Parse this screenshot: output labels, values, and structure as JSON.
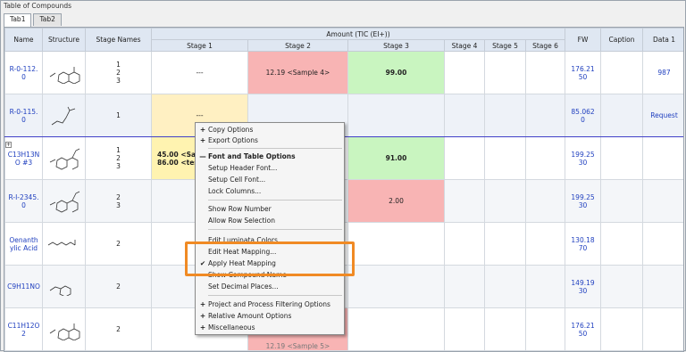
{
  "window": {
    "title": "Table of Compounds"
  },
  "tabs": [
    {
      "label": "Tab1"
    },
    {
      "label": "Tab2"
    }
  ],
  "headers": {
    "name": "Name",
    "structure": "Structure",
    "stage_names": "Stage Names",
    "amount_group": "Amount (TIC (EI+))",
    "stages": [
      "Stage 1",
      "Stage 2",
      "Stage 3",
      "Stage 4",
      "Stage 5",
      "Stage 6"
    ],
    "fw": "FW",
    "caption": "Caption",
    "data1": "Data 1"
  },
  "rows": [
    {
      "name": "R-0-112.\n0",
      "stages": "1\n2\n3",
      "s1": "---",
      "s2": "12.19 <Sample 4>",
      "s3": "99.00",
      "fw": "176.21\n50",
      "data1": "987"
    },
    {
      "name": "R-0-115.\n0",
      "stages": "1",
      "s1": "---",
      "s2": "",
      "s3": "",
      "fw": "85.062\n0",
      "data1": "Request"
    },
    {
      "name": "C13H13N\nO #3",
      "stages": "1\n2\n3",
      "s1": "45.00 <Sar\n86.00 <tes",
      "s2": "",
      "s3": "91.00",
      "fw": "199.25\n30",
      "data1": ""
    },
    {
      "name": "R-I-2345.\n0",
      "stages": "2\n3",
      "s1": "",
      "s2": "",
      "s3": "2.00",
      "fw": "199.25\n30",
      "data1": ""
    },
    {
      "name": "Oenanth\nylic Acid",
      "stages": "2",
      "s1": "",
      "s2": "",
      "s3": "",
      "fw": "130.18\n70",
      "data1": ""
    },
    {
      "name": "C9H11NO",
      "stages": "2",
      "s1": "",
      "s2": "",
      "s3": "",
      "fw": "149.19\n30",
      "data1": ""
    },
    {
      "name": "C11H12O\n2",
      "stages": "2",
      "s1": "",
      "s2": "12.19 <Sample 5>",
      "s3": "",
      "fw": "176.21\n50",
      "data1": ""
    }
  ],
  "context_menu": {
    "items": [
      {
        "label": "Copy Options",
        "glyph": "+"
      },
      {
        "label": "Export Options",
        "glyph": "+"
      },
      {
        "label": "Font and Table Options",
        "glyph": "—"
      },
      {
        "label": "Setup Header Font...",
        "glyph": ""
      },
      {
        "label": "Setup Cell Font...",
        "glyph": ""
      },
      {
        "label": "Lock Columns...",
        "glyph": ""
      },
      {
        "label": "Show Row Number",
        "glyph": ""
      },
      {
        "label": "Allow Row Selection",
        "glyph": ""
      },
      {
        "label": "Edit Luminata Colors",
        "glyph": ""
      },
      {
        "label": "Edit Heat Mapping...",
        "glyph": ""
      },
      {
        "label": "Apply Heat Mapping",
        "glyph": "✔"
      },
      {
        "label": "Show Compound Name",
        "glyph": ""
      },
      {
        "label": "Set Decimal Places...",
        "glyph": ""
      },
      {
        "label": "Project and Process Filtering Options",
        "glyph": "+"
      },
      {
        "label": "Relative Amount Options",
        "glyph": "+"
      },
      {
        "label": "Miscellaneous",
        "glyph": "+"
      }
    ]
  },
  "colors": {
    "heat_red": "#f8b4b4",
    "heat_green": "#c9f5c0",
    "heat_yellow": "#fff3b0",
    "highlight": "#f08a24",
    "link_blue": "#1f3fbf"
  }
}
